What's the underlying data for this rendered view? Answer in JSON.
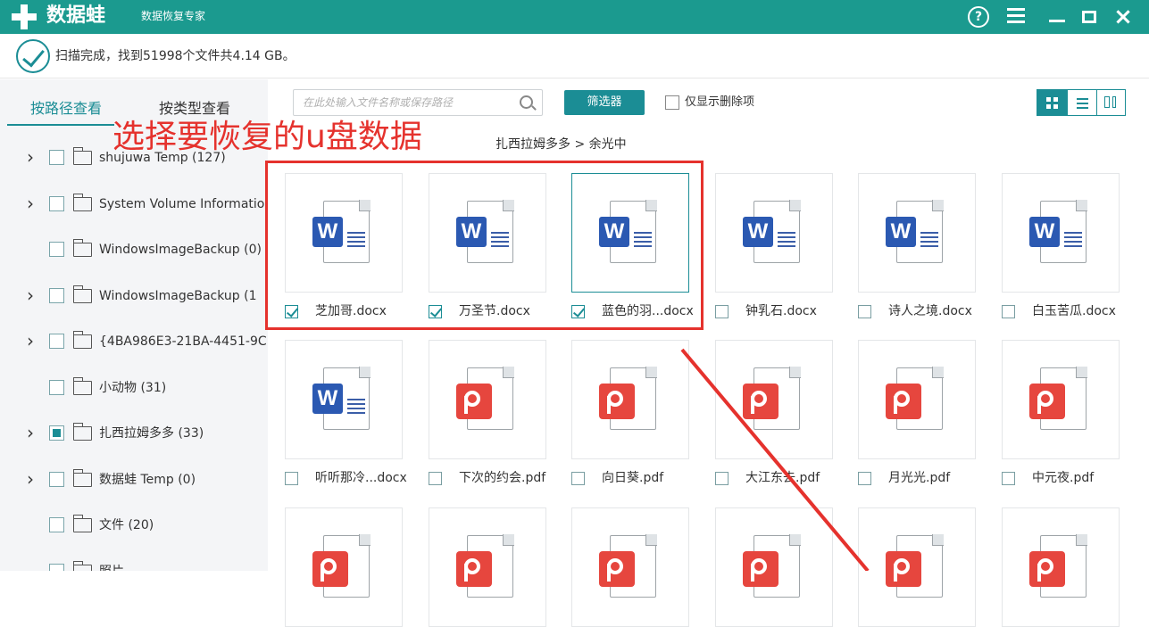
{
  "titlebar": {
    "app_name": "数据蛙",
    "subtitle": "数据恢复专家",
    "help": "?",
    "close": "×"
  },
  "status": {
    "text": "扫描完成，找到51998个文件共4.14 GB。"
  },
  "sidebar": {
    "tab_path": "按路径查看",
    "tab_type": "按类型查看",
    "tree": [
      {
        "label": "shujuwa Temp (127)",
        "has_arrow": true,
        "checked": false
      },
      {
        "label": "System Volume Information",
        "has_arrow": true,
        "checked": false
      },
      {
        "label": "WindowsImageBackup (0)",
        "has_arrow": false,
        "checked": false
      },
      {
        "label": "WindowsImageBackup (1",
        "has_arrow": true,
        "checked": false
      },
      {
        "label": "{4BA986E3-21BA-4451-9C",
        "has_arrow": true,
        "checked": false
      },
      {
        "label": "小动物 (31)",
        "has_arrow": false,
        "checked": false
      },
      {
        "label": "扎西拉姆多多 (33)",
        "has_arrow": true,
        "checked": true
      },
      {
        "label": "数据蛙 Temp (0)",
        "has_arrow": true,
        "checked": false
      },
      {
        "label": "文件 (20)",
        "has_arrow": false,
        "checked": false
      },
      {
        "label": "照片",
        "has_arrow": false,
        "checked": false
      }
    ]
  },
  "toolbar": {
    "search_placeholder": "在此处输入文件名称或保存路径",
    "filter_label": "筛选器",
    "show_deleted_label": "仅显示删除项"
  },
  "breadcrumb": {
    "text": "扎西拉姆多多 > 余光中"
  },
  "overlay": {
    "text": "选择要恢复的u盘数据"
  },
  "files": [
    {
      "name": "芝加哥.docx",
      "type": "word",
      "checked": true
    },
    {
      "name": "万圣节.docx",
      "type": "word",
      "checked": true
    },
    {
      "name": "蓝色的羽...docx",
      "type": "word",
      "checked": true,
      "selected": true
    },
    {
      "name": "钟乳石.docx",
      "type": "word",
      "checked": false
    },
    {
      "name": "诗人之境.docx",
      "type": "word",
      "checked": false
    },
    {
      "name": "白玉苦瓜.docx",
      "type": "word",
      "checked": false
    },
    {
      "name": "听听那冷...docx",
      "type": "word",
      "checked": false
    },
    {
      "name": "下次的约会.pdf",
      "type": "pdf",
      "checked": false
    },
    {
      "name": "向日葵.pdf",
      "type": "pdf",
      "checked": false
    },
    {
      "name": "大江东去.pdf",
      "type": "pdf",
      "checked": false
    },
    {
      "name": "月光光.pdf",
      "type": "pdf",
      "checked": false
    },
    {
      "name": "中元夜.pdf",
      "type": "pdf",
      "checked": false
    },
    {
      "name": "",
      "type": "pdf",
      "checked": false
    },
    {
      "name": "",
      "type": "pdf",
      "checked": false
    },
    {
      "name": "",
      "type": "pdf",
      "checked": false
    },
    {
      "name": "",
      "type": "pdf",
      "checked": false
    },
    {
      "name": "",
      "type": "pdf",
      "checked": false
    },
    {
      "name": "",
      "type": "pdf",
      "checked": false
    }
  ],
  "colors": {
    "accent": "#1b8d95",
    "titlebar": "#1b9a8f",
    "annotation": "#e5322d",
    "word": "#2b59b2",
    "pdf": "#e6463e"
  }
}
